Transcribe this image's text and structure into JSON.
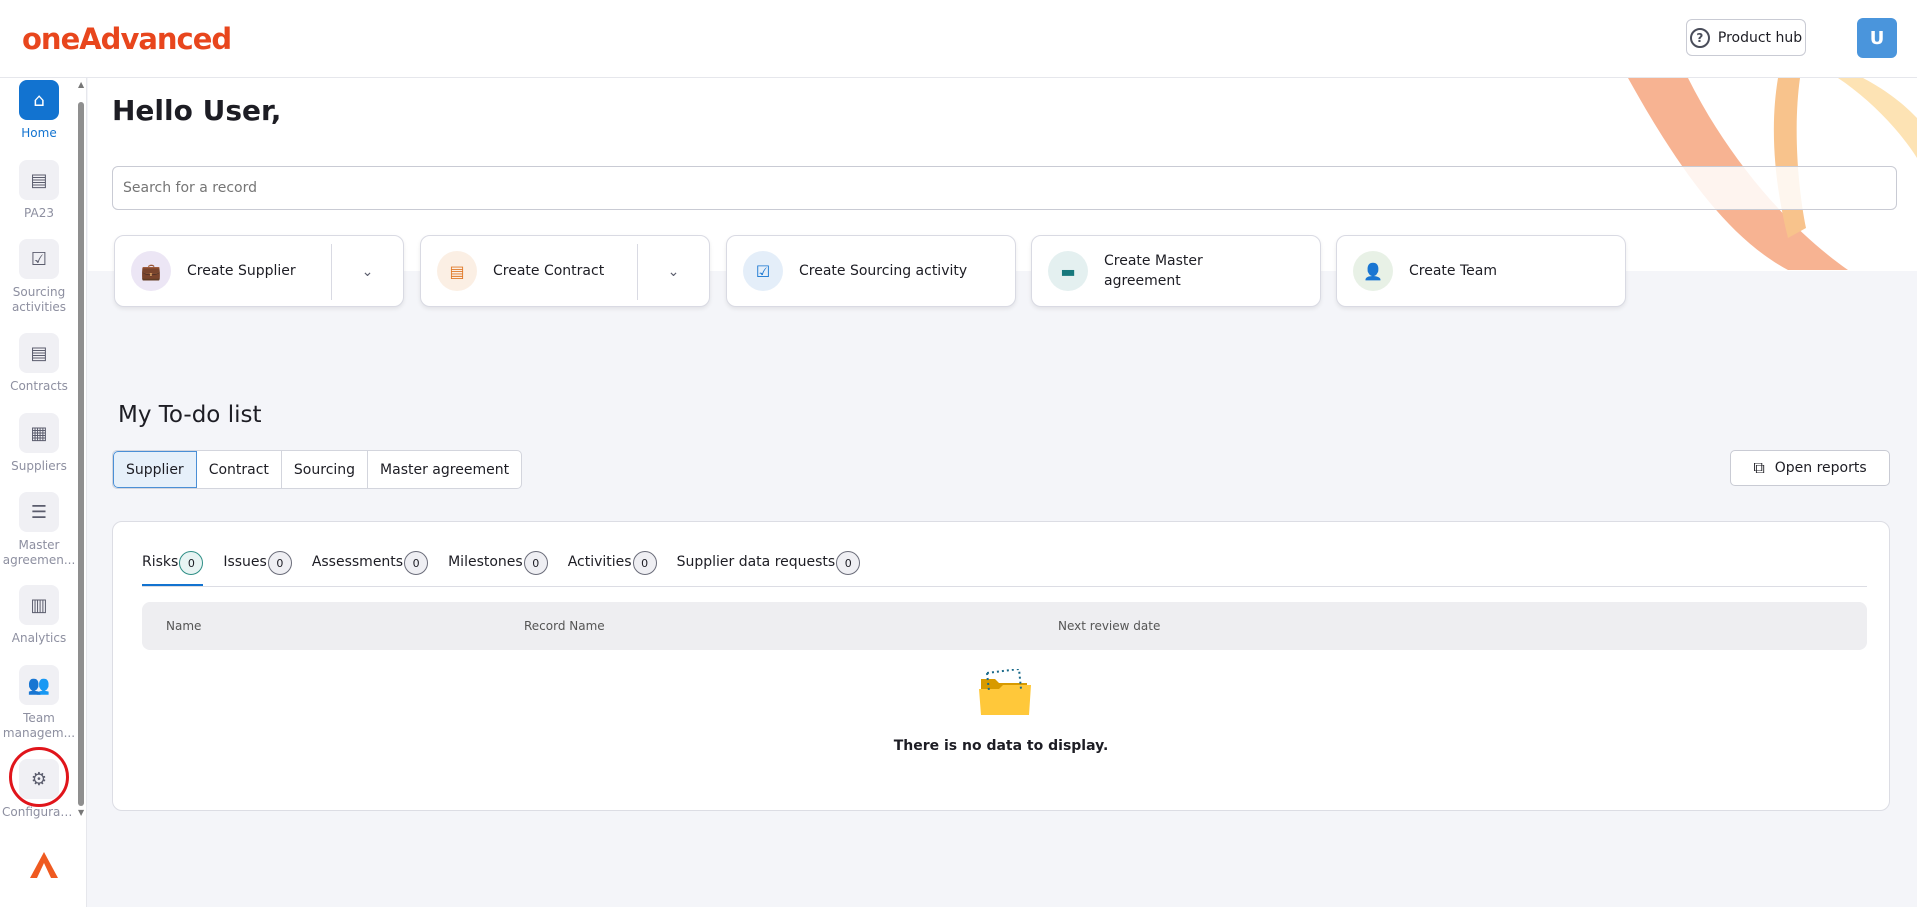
{
  "header": {
    "logo": "oneAdvanced",
    "product_hub": "Product hub",
    "avatar": "U"
  },
  "sidebar": {
    "items": [
      {
        "label": "Home",
        "icon": "home-icon"
      },
      {
        "label": "PA23",
        "icon": "document-icon"
      },
      {
        "label": "Sourcing activities",
        "icon": "checklist-icon"
      },
      {
        "label": "Contracts",
        "icon": "document-icon"
      },
      {
        "label": "Suppliers",
        "icon": "store-icon"
      },
      {
        "label": "Master agreemen...",
        "icon": "agreement-icon"
      },
      {
        "label": "Analytics",
        "icon": "bar-chart-icon"
      },
      {
        "label": "Team managem...",
        "icon": "people-icon"
      },
      {
        "label": "Configurat...",
        "icon": "gear-icon"
      }
    ]
  },
  "main": {
    "greeting": "Hello User,",
    "search_placeholder": "Search for a record",
    "create": [
      {
        "label": "Create Supplier",
        "color": "#4b1a9c"
      },
      {
        "label": "Create Contract",
        "color": "#e07a2a"
      },
      {
        "label": "Create Sourcing activity",
        "color": "#1273d0"
      },
      {
        "label": "Create Master agreement",
        "color": "#17787c"
      },
      {
        "label": "Create Team",
        "color": "#3f7a3b"
      }
    ],
    "todo_title": "My To-do list",
    "todo_tabs": [
      "Supplier",
      "Contract",
      "Sourcing",
      "Master agreement"
    ],
    "open_reports": "Open reports",
    "inner_tabs": [
      {
        "label": "Risks",
        "count": "0"
      },
      {
        "label": "Issues",
        "count": "0"
      },
      {
        "label": "Assessments",
        "count": "0"
      },
      {
        "label": "Milestones",
        "count": "0"
      },
      {
        "label": "Activities",
        "count": "0"
      },
      {
        "label": "Supplier data requests",
        "count": "0"
      }
    ],
    "columns": [
      "Name",
      "Record Name",
      "Next review date"
    ],
    "empty": "There is no data to display."
  }
}
